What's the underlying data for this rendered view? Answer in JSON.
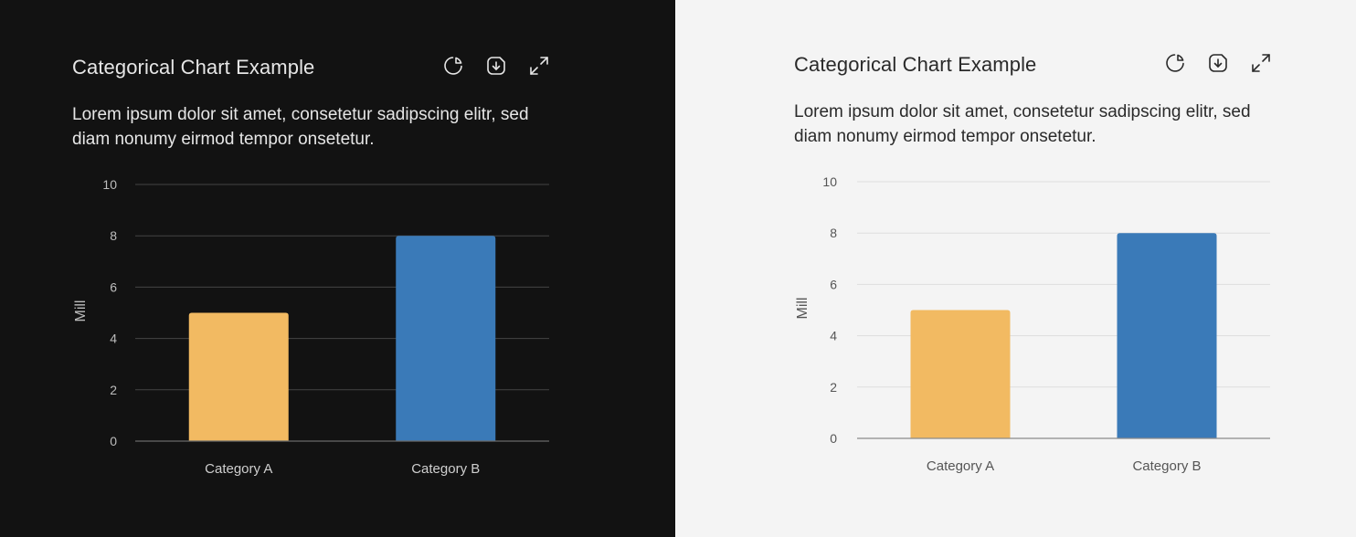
{
  "panels": [
    {
      "theme": "dark",
      "title": "Categorical Chart Example",
      "description": "Lorem ipsum dolor sit amet, consetetur sadipscing elitr, sed diam nonumy eirmod tempor onsetetur.",
      "icons": [
        "pie-chart-icon",
        "download-icon",
        "expand-icon"
      ]
    },
    {
      "theme": "light",
      "title": "Categorical Chart Example",
      "description": "Lorem ipsum dolor sit amet, consetetur sadipscing elitr, sed diam nonumy eirmod tempor onsetetur.",
      "icons": [
        "pie-chart-icon",
        "download-icon",
        "expand-icon"
      ]
    }
  ],
  "colors": {
    "dark_bg": "#121212",
    "light_bg": "#f4f4f4",
    "category_a": "#F2BA62",
    "category_b": "#3A7AB8"
  },
  "chart_data": [
    {
      "type": "bar",
      "categories": [
        "Category A",
        "Category B"
      ],
      "values": [
        5,
        8
      ],
      "colors": [
        "#F2BA62",
        "#3A7AB8"
      ],
      "ylabel": "Mill",
      "ylim": [
        0,
        10
      ],
      "yticks": [
        0,
        2,
        4,
        6,
        8,
        10
      ],
      "grid": true
    },
    {
      "type": "bar",
      "categories": [
        "Category A",
        "Category B"
      ],
      "values": [
        5,
        8
      ],
      "colors": [
        "#F2BA62",
        "#3A7AB8"
      ],
      "ylabel": "Mill",
      "ylim": [
        0,
        10
      ],
      "yticks": [
        0,
        2,
        4,
        6,
        8,
        10
      ],
      "grid": true
    }
  ]
}
